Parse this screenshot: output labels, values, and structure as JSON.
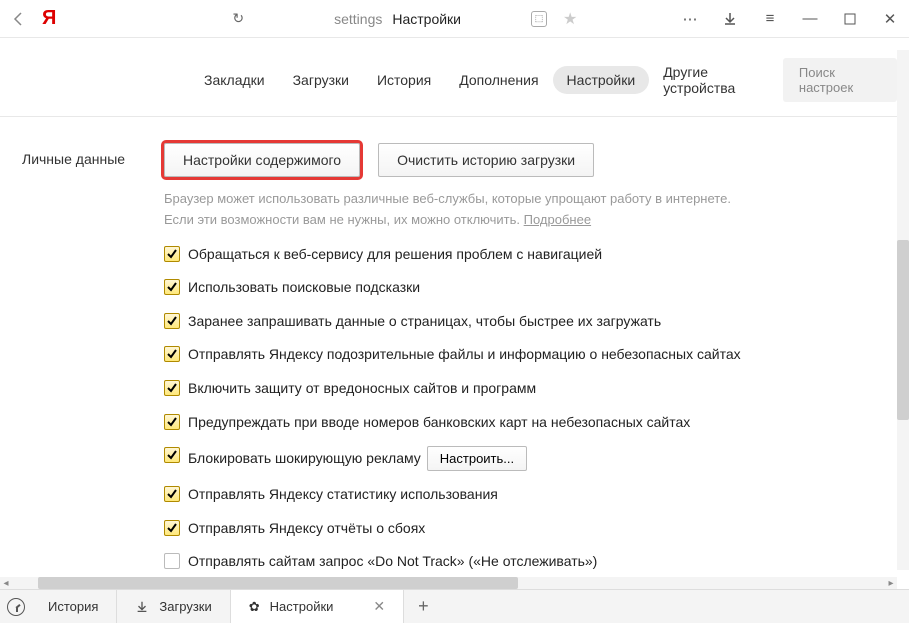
{
  "titlebar": {
    "address_path": "settings",
    "address_title": "Настройки"
  },
  "nav": {
    "items": [
      "Закладки",
      "Загрузки",
      "История",
      "Дополнения",
      "Настройки",
      "Другие устройства"
    ],
    "search_placeholder": "Поиск настроек"
  },
  "section": {
    "label": "Личные данные",
    "btn_content": "Настройки содержимого",
    "btn_clear": "Очистить историю загрузки",
    "hint1": "Браузер может использовать различные веб-службы, которые упрощают работу в интернете.",
    "hint2": "Если эти возможности вам не нужны, их можно отключить. ",
    "hint_link": "Подробнее"
  },
  "checks": [
    {
      "checked": true,
      "label": "Обращаться к веб-сервису для решения проблем с навигацией"
    },
    {
      "checked": true,
      "label": "Использовать поисковые подсказки"
    },
    {
      "checked": true,
      "label": "Заранее запрашивать данные о страницах, чтобы быстрее их загружать"
    },
    {
      "checked": true,
      "label": "Отправлять Яндексу подозрительные файлы и информацию о небезопасных сайтах"
    },
    {
      "checked": true,
      "label": "Включить защиту от вредоносных сайтов и программ"
    },
    {
      "checked": true,
      "label": "Предупреждать при вводе номеров банковских карт на небезопасных сайтах"
    },
    {
      "checked": true,
      "label": "Блокировать шокирующую рекламу",
      "inline_btn": "Настроить..."
    },
    {
      "checked": true,
      "label": "Отправлять Яндексу статистику использования"
    },
    {
      "checked": true,
      "label": "Отправлять Яндексу отчёты о сбоях"
    },
    {
      "checked": false,
      "label": "Отправлять сайтам запрос «Do Not Track» («Не отслеживать»)"
    }
  ],
  "bottom": {
    "history": "История",
    "downloads": "Загрузки",
    "settings": "Настройки"
  }
}
